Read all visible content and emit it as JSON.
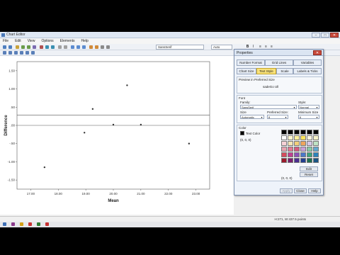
{
  "window": {
    "title": "Chart Editor",
    "buttons": [
      "–",
      "□",
      "✕"
    ]
  },
  "menu": [
    "File",
    "Edit",
    "View",
    "Options",
    "Elements",
    "Help"
  ],
  "toolbar": {
    "font_family": "SansSerif",
    "font_size": "Auto",
    "bold": "B",
    "italic": "I",
    "align_left": "≡",
    "align_center": "≡",
    "align_right": "≡"
  },
  "status": {
    "info": "H:271, W:437.5 points"
  },
  "chart_data": {
    "type": "scatter",
    "xlabel": "Mean",
    "ylabel": "Difference",
    "xticks": [
      "17.00",
      "18.00",
      "19.00",
      "20.00",
      "21.00",
      "22.00",
      "23.00"
    ],
    "yticks": [
      "1.50",
      "1.00",
      ".50",
      ".00",
      "-.50",
      "-1.00",
      "-1.50"
    ],
    "xlim": [
      16.5,
      23.5
    ],
    "ylim": [
      -1.75,
      1.75
    ],
    "points": [
      {
        "x": 17.5,
        "y": -1.15
      },
      {
        "x": 18.95,
        "y": -0.2
      },
      {
        "x": 19.25,
        "y": 0.45
      },
      {
        "x": 20.0,
        "y": 0.02
      },
      {
        "x": 20.5,
        "y": 1.1
      },
      {
        "x": 21.0,
        "y": 0.02
      },
      {
        "x": 22.75,
        "y": -0.5
      }
    ],
    "hlines": [
      0.28,
      0.0
    ],
    "grid": false
  },
  "properties": {
    "title": "Properties",
    "close": "✕",
    "tabs_row1": [
      "Number Format",
      "Grid Lines",
      "Variables"
    ],
    "tabs_row2": [
      "Chart Size",
      "Text Style",
      "Scale",
      "Labels & Ticks"
    ],
    "preview_label": "Preview in Preferred Size",
    "preview_text": "sadeGo Ull",
    "font_section": "Font",
    "family_label": "Family:",
    "family_value": "SansSerif",
    "style_label": "Style:",
    "style_value": "Normal",
    "size_label": "Size",
    "size_value": "Automatic",
    "preferred_label": "Preferred Size:",
    "preferred_value": "8",
    "minimum_label": "Minimum Size",
    "minimum_value": "6",
    "color_section": "Color",
    "text_color_label": "Text Color",
    "rgb_value": "(0, 0, 0)",
    "rgb_value2": "(0, 0, 0)",
    "edit_label": "Edit",
    "reset_label": "Reset",
    "apply_label": "Apply",
    "close_label": "Close",
    "help_label": "Help",
    "text_color": "#000000",
    "swatches": [
      "#000000",
      "#000000",
      "#000000",
      "#000000",
      "#000000",
      "#000000",
      "#ffffff",
      "#fff6cf",
      "#fcef9b",
      "#ffe55e",
      "#fff7e0",
      "#f6f2c8",
      "#f7d3d8",
      "#f4e6b7",
      "#f2cf7a",
      "#f0a55c",
      "#d7c8e7",
      "#bfe3c5",
      "#e7a3b1",
      "#e07a92",
      "#d45a7e",
      "#c9a0d8",
      "#89c9a8",
      "#62a9cf",
      "#d64c5c",
      "#c04090",
      "#8d52b8",
      "#4b78c9",
      "#3ea37d",
      "#2b83bd",
      "#9b1a2b",
      "#7a1f6e",
      "#4a2e8f",
      "#233e8f",
      "#1f6f52",
      "#1a5585"
    ],
    "swatch_default": "#eef3fa"
  }
}
